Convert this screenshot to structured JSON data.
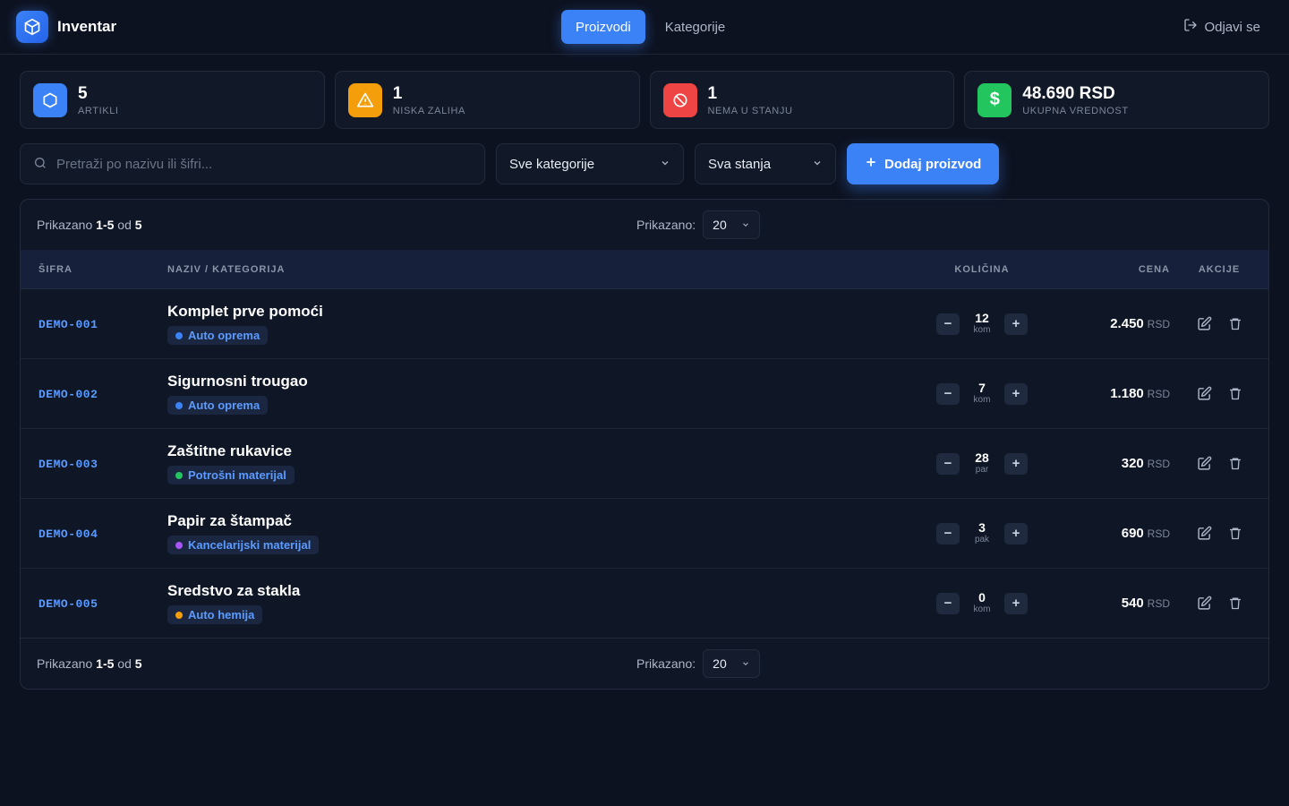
{
  "app": {
    "title": "Inventar"
  },
  "nav": {
    "tabs": [
      {
        "label": "Proizvodi"
      },
      {
        "label": "Kategorije"
      }
    ],
    "logout": "Odjavi se"
  },
  "stats": [
    {
      "value": "5",
      "label": "ARTIKLI",
      "icon": "box-icon",
      "color": "#3b82f6"
    },
    {
      "value": "1",
      "label": "NISKA ZALIHA",
      "icon": "warning-icon",
      "color": "#f59e0b"
    },
    {
      "value": "1",
      "label": "NEMA U STANJU",
      "icon": "ban-icon",
      "color": "#ef4444"
    },
    {
      "value": "48.690 RSD",
      "label": "UKUPNA VREDNOST",
      "icon": "dollar-icon",
      "color": "#22c55e"
    }
  ],
  "filters": {
    "search_placeholder": "Pretraži po nazivu ili šifri...",
    "category": "Sve kategorije",
    "status": "Sva stanja",
    "add_button": "Dodaj proizvod"
  },
  "pager": {
    "prefix": "Prikazano",
    "range": "1-5",
    "of": "od",
    "total": "5",
    "per_page_label": "Prikazano:",
    "per_page": "20"
  },
  "table": {
    "headers": {
      "code": "ŠIFRA",
      "name": "NAZIV / KATEGORIJA",
      "qty": "KOLIČINA",
      "price": "CENA",
      "actions": "AKCIJE"
    },
    "rows": [
      {
        "code": "DEMO-001",
        "name": "Komplet prve pomoći",
        "category": "Auto oprema",
        "cat_color": "#3b82f6",
        "qty": "12",
        "unit": "kom",
        "price": "2.450",
        "currency": "RSD"
      },
      {
        "code": "DEMO-002",
        "name": "Sigurnosni trougao",
        "category": "Auto oprema",
        "cat_color": "#3b82f6",
        "qty": "7",
        "unit": "kom",
        "price": "1.180",
        "currency": "RSD"
      },
      {
        "code": "DEMO-003",
        "name": "Zaštitne rukavice",
        "category": "Potrošni materijal",
        "cat_color": "#22c55e",
        "qty": "28",
        "unit": "par",
        "price": "320",
        "currency": "RSD"
      },
      {
        "code": "DEMO-004",
        "name": "Papir za štampač",
        "category": "Kancelarijski materijal",
        "cat_color": "#a855f7",
        "qty": "3",
        "unit": "pak",
        "price": "690",
        "currency": "RSD"
      },
      {
        "code": "DEMO-005",
        "name": "Sredstvo za stakla",
        "category": "Auto hemija",
        "cat_color": "#f59e0b",
        "qty": "0",
        "unit": "kom",
        "price": "540",
        "currency": "RSD"
      }
    ]
  }
}
